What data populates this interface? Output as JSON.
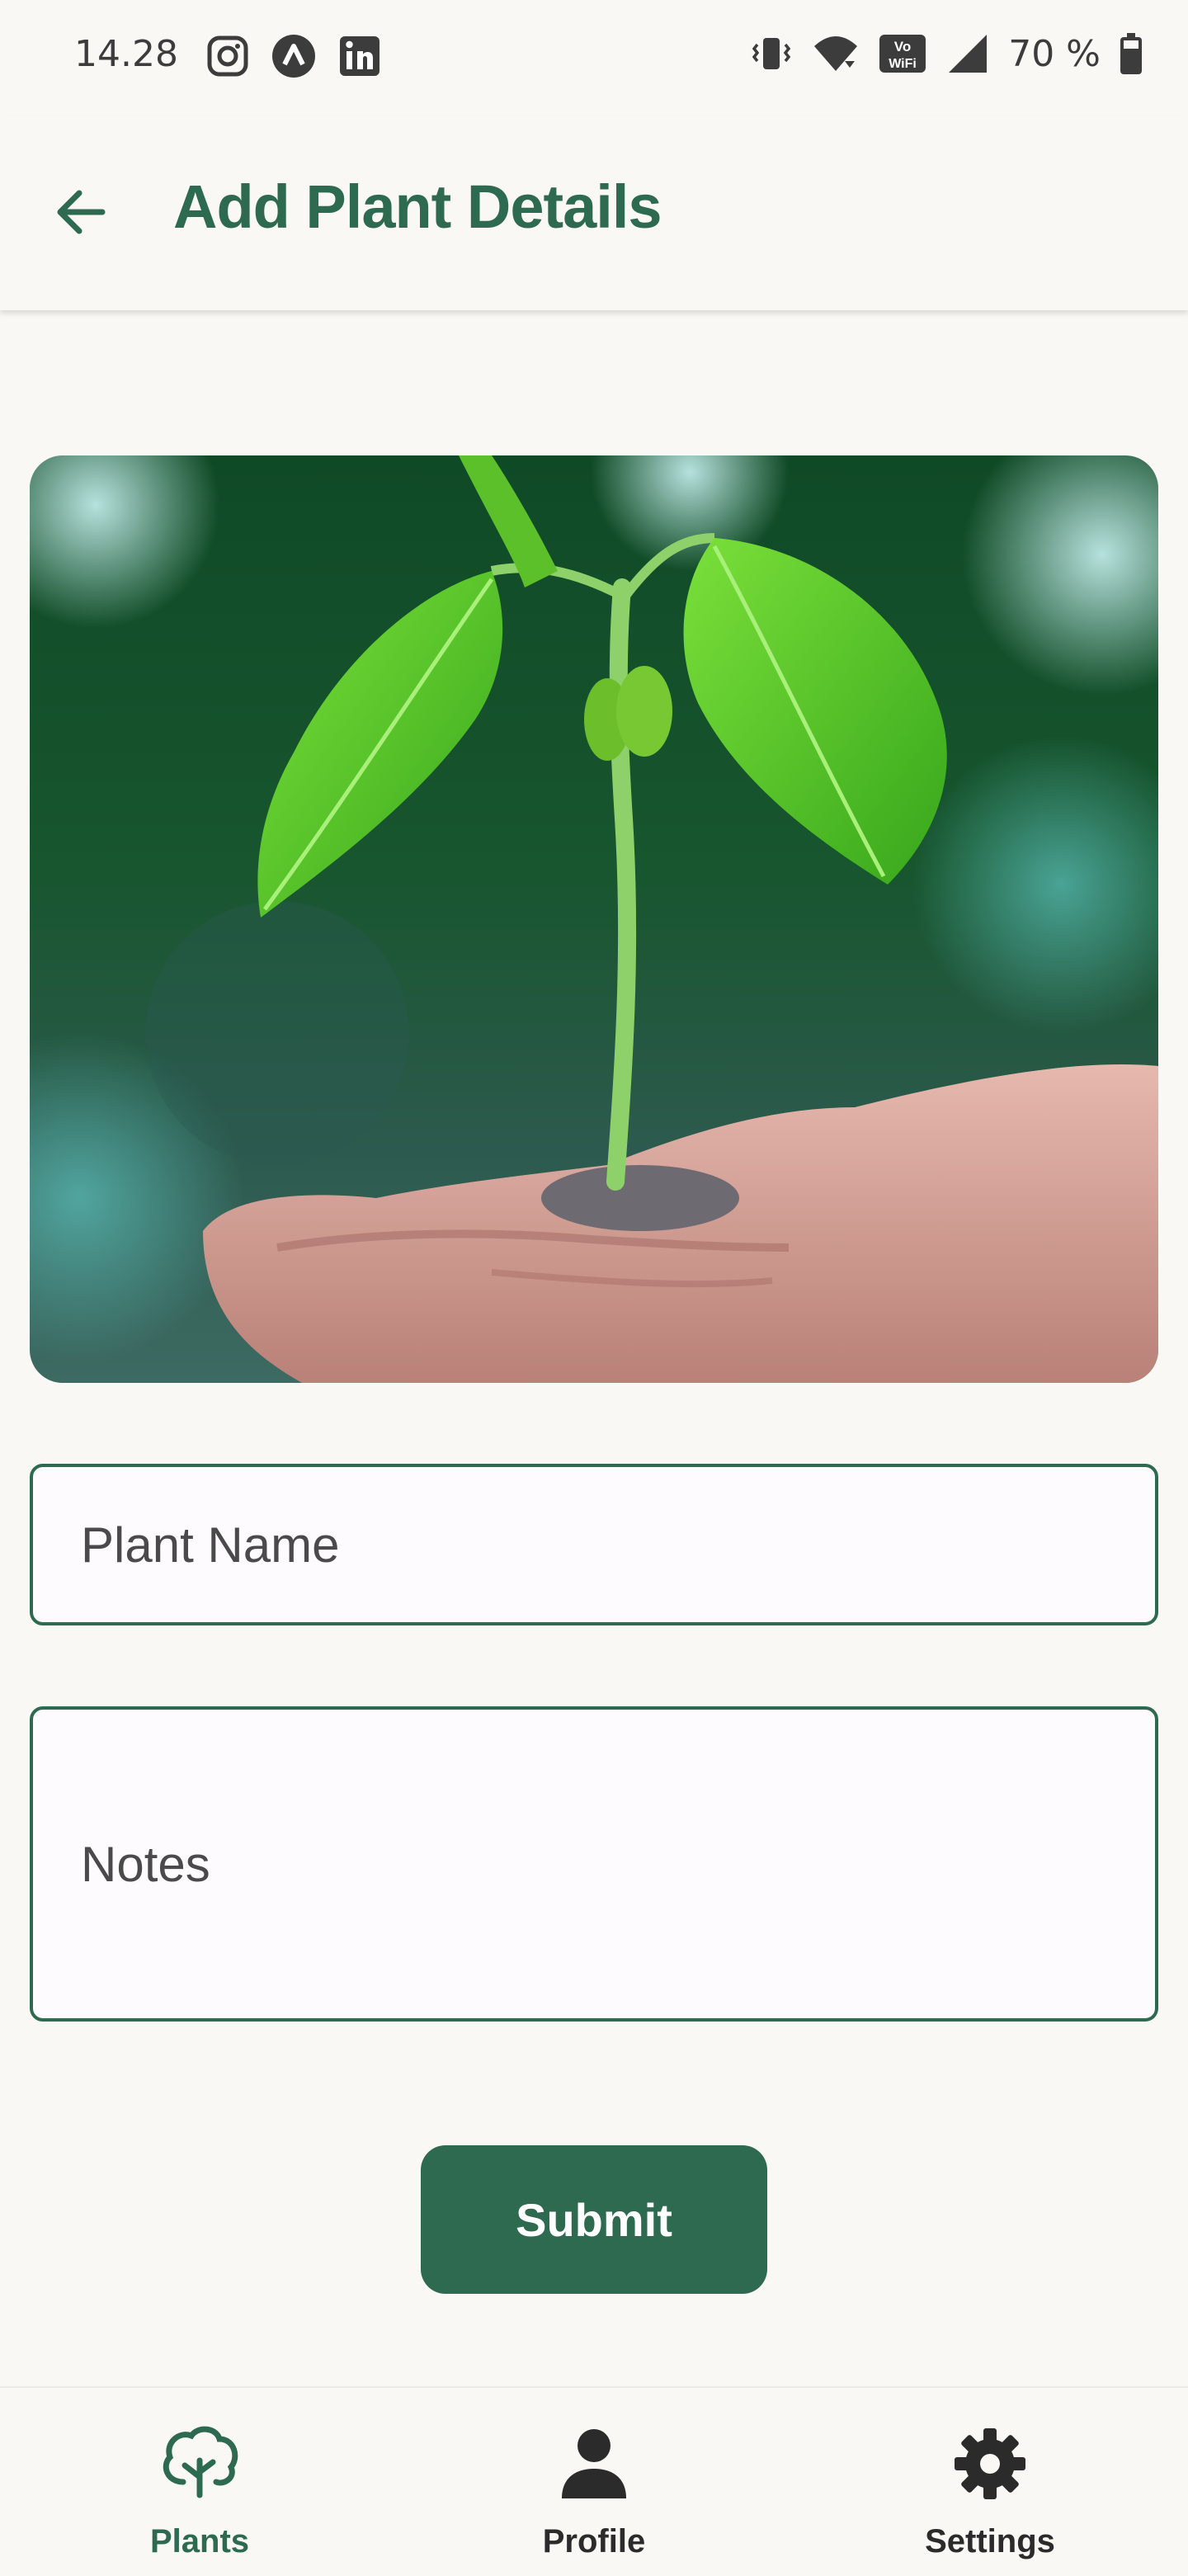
{
  "status_bar": {
    "time": "14.28",
    "battery_text": "70 %",
    "left_icons": [
      "instagram-icon",
      "app-a-icon",
      "linkedin-icon"
    ],
    "right_icons": [
      "vibrate-icon",
      "wifi-icon",
      "vowifi-icon",
      "signal-icon",
      "battery-icon"
    ]
  },
  "app_bar": {
    "title": "Add Plant Details",
    "back_icon": "arrow-left-icon"
  },
  "photo": {
    "subject": "seedling held in hand"
  },
  "form": {
    "plant_name_placeholder": "Plant Name",
    "notes_placeholder": "Notes",
    "submit_label": "Submit"
  },
  "bottom_nav": {
    "items": [
      {
        "label": "Plants",
        "icon": "tree-icon",
        "active": true
      },
      {
        "label": "Profile",
        "icon": "person-icon",
        "active": false
      },
      {
        "label": "Settings",
        "icon": "gear-icon",
        "active": false
      }
    ]
  },
  "colors": {
    "accent": "#2e6a4f",
    "background": "#f9f8f4",
    "field_background": "#fefbfe",
    "text": "#2b2b2b"
  }
}
